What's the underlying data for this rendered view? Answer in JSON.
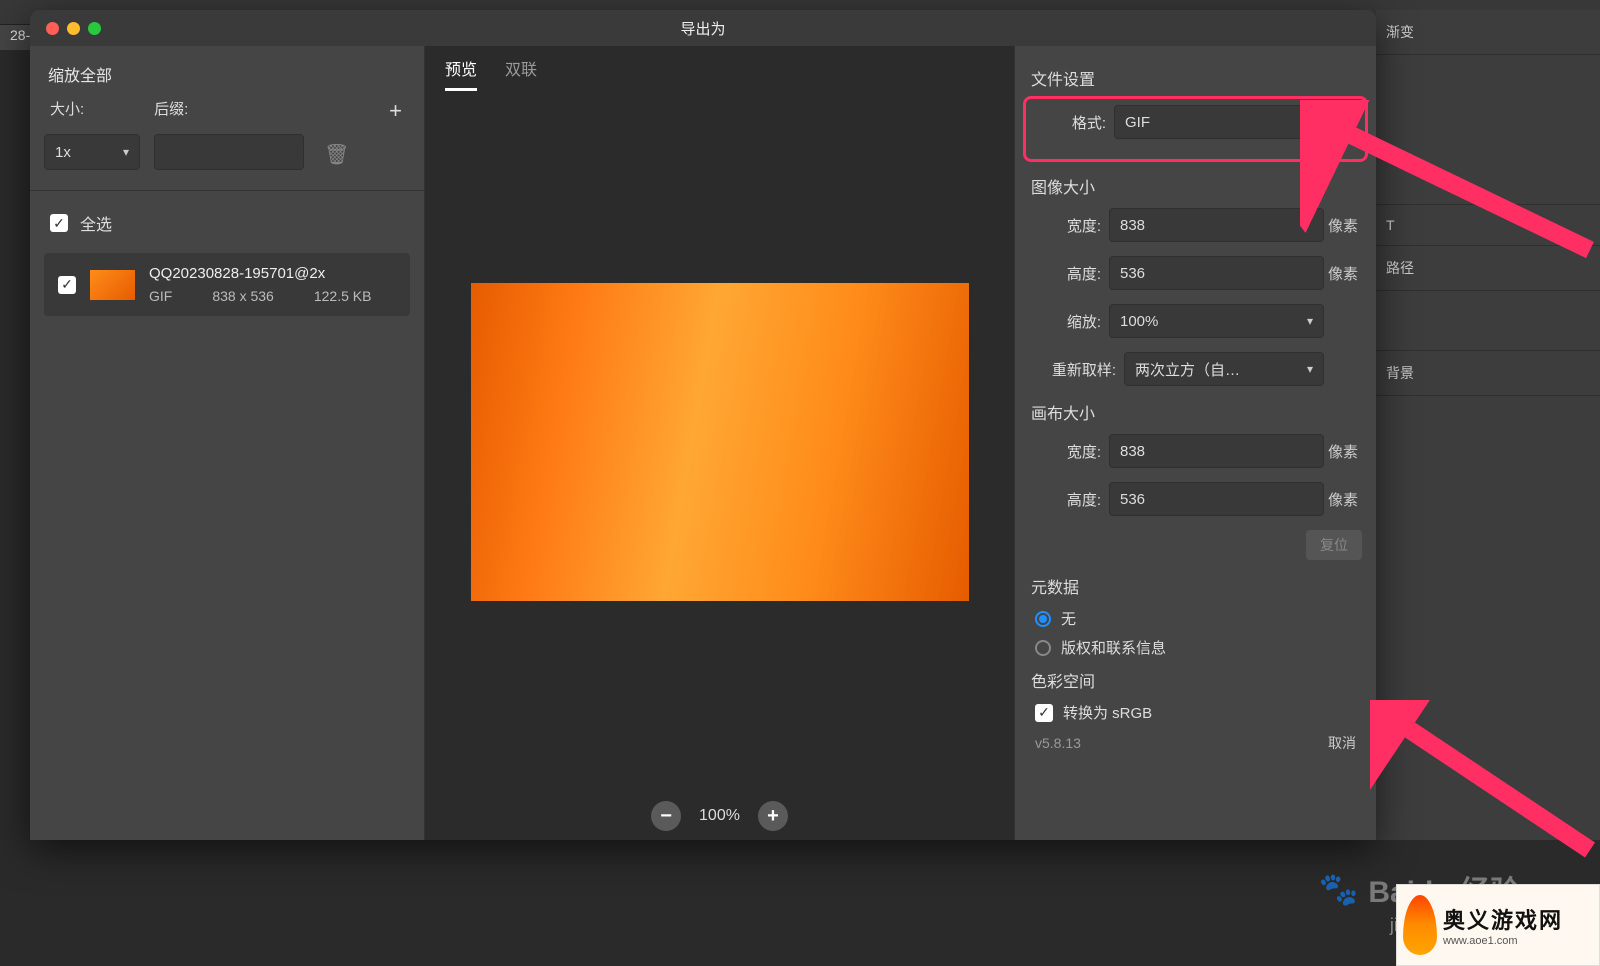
{
  "bg": {
    "tab_text": "28-…",
    "right_items": [
      "渐变",
      "T",
      "路径",
      "背景"
    ]
  },
  "dialog": {
    "title": "导出为",
    "left": {
      "scale_title": "缩放全部",
      "size_label": "大小:",
      "suffix_label": "后缀:",
      "size_value": "1x",
      "select_all": "全选",
      "asset": {
        "name": "QQ20230828-195701@2x",
        "format": "GIF",
        "dims": "838 x 536",
        "size": "122.5 KB"
      }
    },
    "center": {
      "tabs": [
        "预览",
        "双联"
      ],
      "zoom": "100%"
    },
    "right": {
      "file_settings": "文件设置",
      "format_label": "格式:",
      "format_value": "GIF",
      "image_size": "图像大小",
      "width_label": "宽度:",
      "width_value": "838",
      "height_label": "高度:",
      "height_value": "536",
      "scale_label": "缩放:",
      "scale_value": "100%",
      "resample_label": "重新取样:",
      "resample_value": "两次立方（自…",
      "unit": "像素",
      "canvas_size": "画布大小",
      "canvas_w": "838",
      "canvas_h": "536",
      "reset": "复位",
      "metadata": "元数据",
      "meta_none": "无",
      "meta_copyright": "版权和联系信息",
      "colorspace": "色彩空间",
      "convert_srgb": "转换为 sRGB",
      "version": "v5.8.13",
      "cancel": "取消"
    }
  },
  "watermark": {
    "brand": "Baidu 经验",
    "sub": "jingyan.ba…"
  },
  "corner": {
    "cn": "奥义游戏网",
    "en": "www.aoe1.com"
  }
}
